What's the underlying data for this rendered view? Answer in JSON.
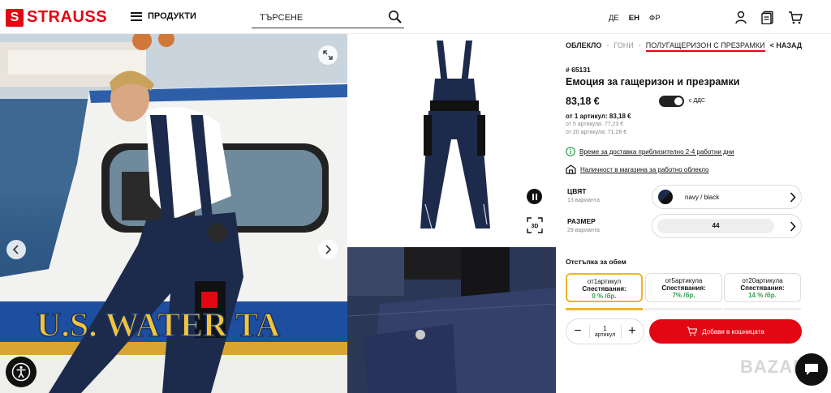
{
  "header": {
    "logo_text": "STRAUSS",
    "menu_label": "ПРОДУКТИ",
    "search_placeholder": "ТЪРСЕНЕ",
    "languages": [
      "ДЕ",
      "ЕН",
      "ФР"
    ]
  },
  "breadcrumb": {
    "item1": "ОБЛЕКЛО",
    "item2": "ГОНИ",
    "current": "ПОЛУГАЩЕРИЗОН С ПРЕЗРАМКИ",
    "back": "НАЗАД"
  },
  "product": {
    "sku": "# 65131",
    "title": "Емоция за гащеризон и презрамки",
    "price": "83,18 €",
    "vat_label": "с ДДС",
    "tier_main": "от 1 артикул: 83,18 €",
    "tier_5": "от 5 артикула: 77,23 €",
    "tier_20": "от 20 артикула: 71,28 €",
    "delivery": "Време за доставка приблизително 2-4 работни дни",
    "store": "Наличност в магазина за работно облекло"
  },
  "options": {
    "color_label": "ЦВЯТ",
    "color_count": "13 варианта",
    "color_value": "navy / black",
    "size_label": "РАЗМЕР",
    "size_count": "29 варианта",
    "size_value": "44"
  },
  "bulk": {
    "title": "Отстъпка за обем",
    "tiers": [
      {
        "qty": "от1артикул",
        "label": "Спестявания:",
        "saving": "0 % /бр."
      },
      {
        "qty": "от5артикула",
        "label": "Спестявания:",
        "saving": "7% /бр."
      },
      {
        "qty": "от20артикула",
        "label": "Спестявания:",
        "saving": "14 % /бр."
      }
    ]
  },
  "cart": {
    "qty_value": "1",
    "qty_unit": "артикул",
    "add_label": "Добави в кошницата"
  },
  "photo": {
    "boat_text": "U.S. WATER TA"
  },
  "watermark": "BAZAR",
  "colors": {
    "brand_red": "#e30613",
    "navy": "#1b2a4a",
    "accent_yellow": "#f0b429",
    "saving_green": "#2e9e4b"
  }
}
